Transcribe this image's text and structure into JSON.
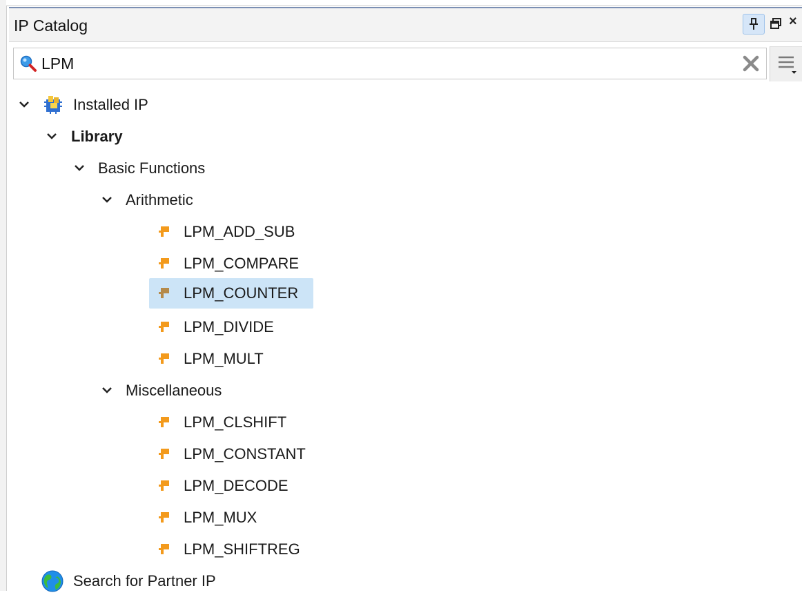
{
  "title": "IP Catalog",
  "search": {
    "value": "LPM"
  },
  "tree": {
    "installed": "Installed IP",
    "library": "Library",
    "basic_functions": "Basic Functions",
    "arithmetic": {
      "label": "Arithmetic",
      "items": [
        "LPM_ADD_SUB",
        "LPM_COMPARE",
        "LPM_COUNTER",
        "LPM_DIVIDE",
        "LPM_MULT"
      ]
    },
    "misc": {
      "label": "Miscellaneous",
      "items": [
        "LPM_CLSHIFT",
        "LPM_CONSTANT",
        "LPM_DECODE",
        "LPM_MUX",
        "LPM_SHIFTREG"
      ]
    },
    "partner": "Search for Partner IP"
  },
  "selected_item": "LPM_COUNTER",
  "colors": {
    "selection": "#cce4f7",
    "ip_icon": "#f39a1c",
    "accent": "#7b8fb3"
  },
  "icons": [
    "search-icon",
    "clear-icon",
    "menu-icon",
    "pin-icon",
    "float-icon",
    "close-icon",
    "chevron-down-icon",
    "ip-icon",
    "installed-ip-icon",
    "globe-icon"
  ]
}
